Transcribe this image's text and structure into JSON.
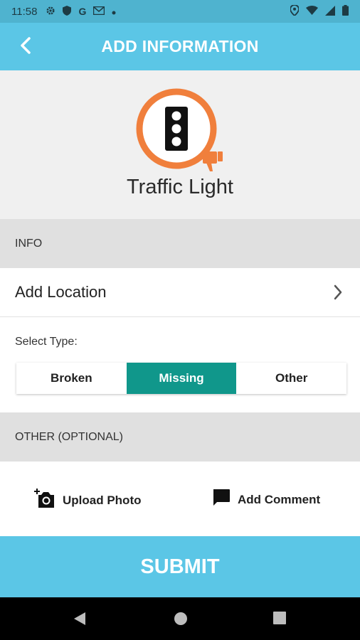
{
  "status_bar": {
    "time": "11:58",
    "left_icons": [
      "gear-icon",
      "shield-icon",
      "google-g-icon",
      "mail-icon",
      "dot-icon"
    ],
    "right_icons": [
      "location-icon",
      "wifi-icon",
      "signal-icon",
      "battery-icon"
    ]
  },
  "app_bar": {
    "title": "ADD INFORMATION",
    "back_icon": "chevron-left-icon"
  },
  "hero": {
    "title": "Traffic Light",
    "icon": "traffic-light-thumbs-down-icon",
    "accent_color": "#f07f3c"
  },
  "info_section": {
    "header": "INFO",
    "location_label": "Add Location",
    "select_type_label": "Select Type:",
    "type_options": [
      "Broken",
      "Missing",
      "Other"
    ],
    "selected_type": "Missing"
  },
  "other_section": {
    "header": "OTHER (OPTIONAL)",
    "upload_photo_label": "Upload Photo",
    "add_comment_label": "Add Comment"
  },
  "submit_label": "SUBMIT",
  "colors": {
    "primary": "#5bc6e6",
    "status_bar": "#4fb3cf",
    "selected_segment": "#10978b",
    "section_bg": "#e0e0e0",
    "hero_bg": "#f0f0f0"
  }
}
